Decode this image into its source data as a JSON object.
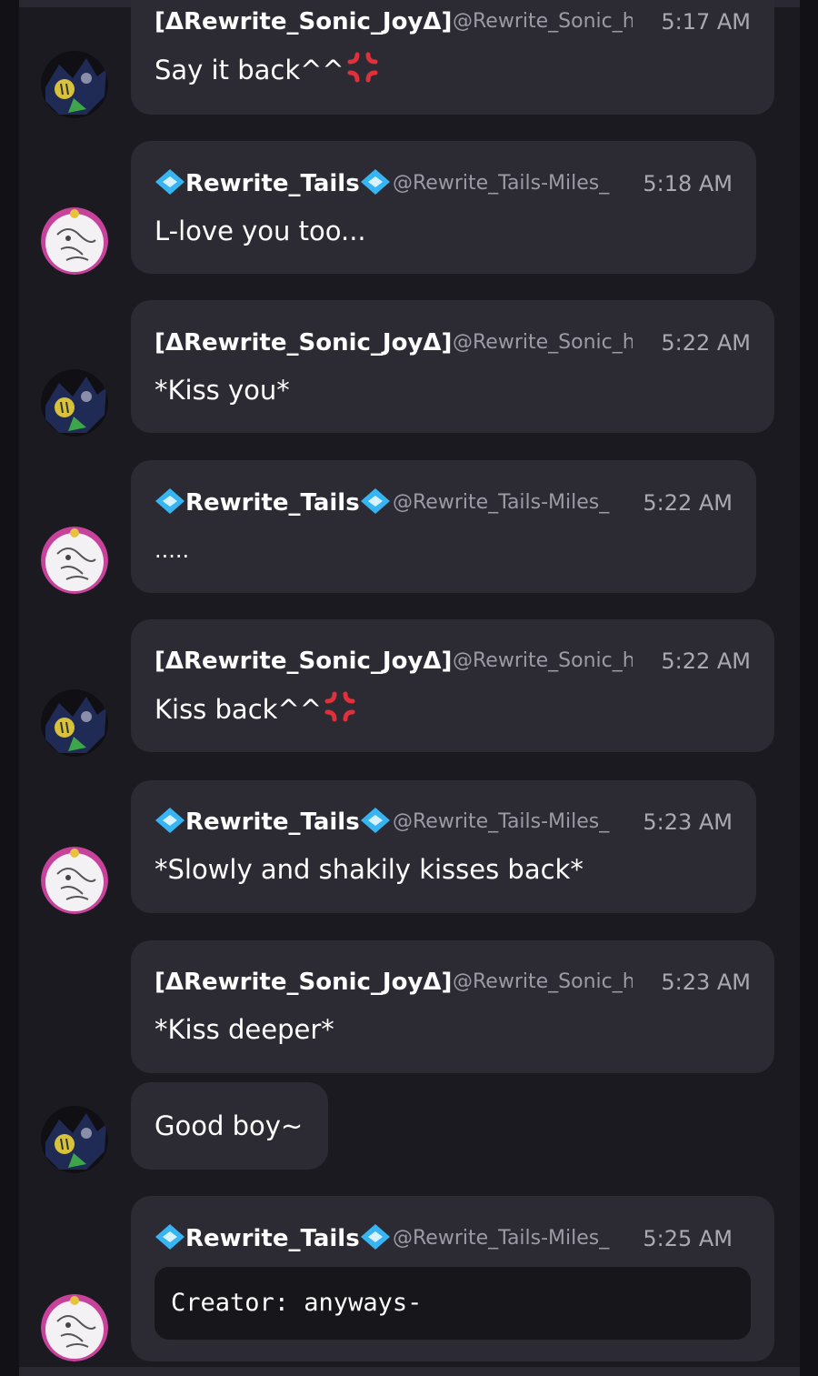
{
  "users": {
    "sonic": {
      "name": "[ΔRewrite_Sonic_JoyΔ]",
      "handle": "@Rewrite_Sonic_h",
      "avatar_icon": "dark-sonic-avatar-icon"
    },
    "tails": {
      "name": "Rewrite_Tails",
      "handle": "@Rewrite_Tails-Miles_",
      "avatar_icon": "white-tails-avatar-icon",
      "name_decoration": "blue-diamond-icon"
    }
  },
  "messages": [
    {
      "author": "sonic",
      "time": "5:17 AM",
      "text": "Say it back^^",
      "emoji": "anger-symbol-icon"
    },
    {
      "author": "tails",
      "time": "5:18 AM",
      "text": "L-love you too..."
    },
    {
      "author": "sonic",
      "time": "5:22 AM",
      "text": "*Kiss you*"
    },
    {
      "author": "tails",
      "time": "5:22 AM",
      "text": "....."
    },
    {
      "author": "sonic",
      "time": "5:22 AM",
      "text": "Kiss back^^",
      "emoji": "anger-symbol-icon"
    },
    {
      "author": "tails",
      "time": "5:23 AM",
      "text": "*Slowly and shakily kisses back*"
    },
    {
      "author": "sonic",
      "time": "5:23 AM",
      "text": "*Kiss deeper*"
    },
    {
      "author": "sonic",
      "time": "",
      "text": "Good boy~"
    },
    {
      "author": "tails",
      "time": "5:25 AM",
      "code": "Creator: anyways-"
    }
  ],
  "colors": {
    "background": "#1b1a20",
    "bubble": "#2c2b34",
    "code_block": "#17161b",
    "anger": "#e0303a",
    "diamond": "#37b5f2"
  }
}
